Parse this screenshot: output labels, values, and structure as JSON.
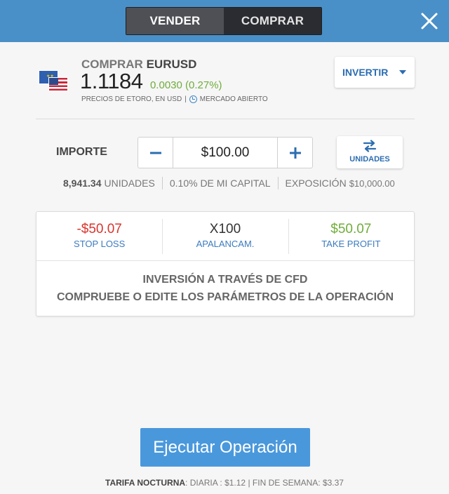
{
  "header": {
    "toggle": {
      "sell_label": "VENDER",
      "buy_label": "COMPRAR",
      "active": "VENDER"
    },
    "close_icon": "close-icon"
  },
  "asset": {
    "action_label": "COMPRAR",
    "symbol": "EURUSD",
    "price": "1.1184",
    "change": "0.0030 (0.27%)",
    "prices_note": "PRECIOS DE ETORO, EN USD",
    "market_status": "MERCADO ABIERTO",
    "flag_icon": "eu-us-flag-icon"
  },
  "invert_button": {
    "label": "INVERTIR"
  },
  "amount": {
    "label": "IMPORTE",
    "value": "$100.00",
    "minus": "−",
    "plus": "+",
    "units_toggle_label": "UNIDADES"
  },
  "stats": {
    "units_value": "8,941.34",
    "units_label": "UNIDADES",
    "capital_text": "0.10% DE MI CAPITAL",
    "exposure_label": "EXPOSICIÓN",
    "exposure_value": "$10,000.00"
  },
  "settings": {
    "stop_loss": {
      "value": "-$50.07",
      "label": "STOP LOSS"
    },
    "leverage": {
      "value": "X100",
      "label": "APALANCAM."
    },
    "take_profit": {
      "value": "$50.07",
      "label": "TAKE PROFIT"
    },
    "cfd_line1": "INVERSIÓN A TRAVÉS DE CFD",
    "cfd_line2": "COMPRUEBE O EDITE LOS PARÁMETROS DE LA OPERACIÓN"
  },
  "execute_button": {
    "label": "Ejecutar Operación"
  },
  "fees": {
    "label": "TARIFA NOCTURNA",
    "daily_label": "DIARIA :",
    "daily_value": "$1.12",
    "weekend_label": "FIN DE SEMANA:",
    "weekend_value": "$3.37"
  },
  "colors": {
    "header": "#4a90c8",
    "accent": "#2b6db0",
    "positive": "#6fad3b",
    "negative": "#d8342c",
    "execute": "#4a98dc"
  }
}
